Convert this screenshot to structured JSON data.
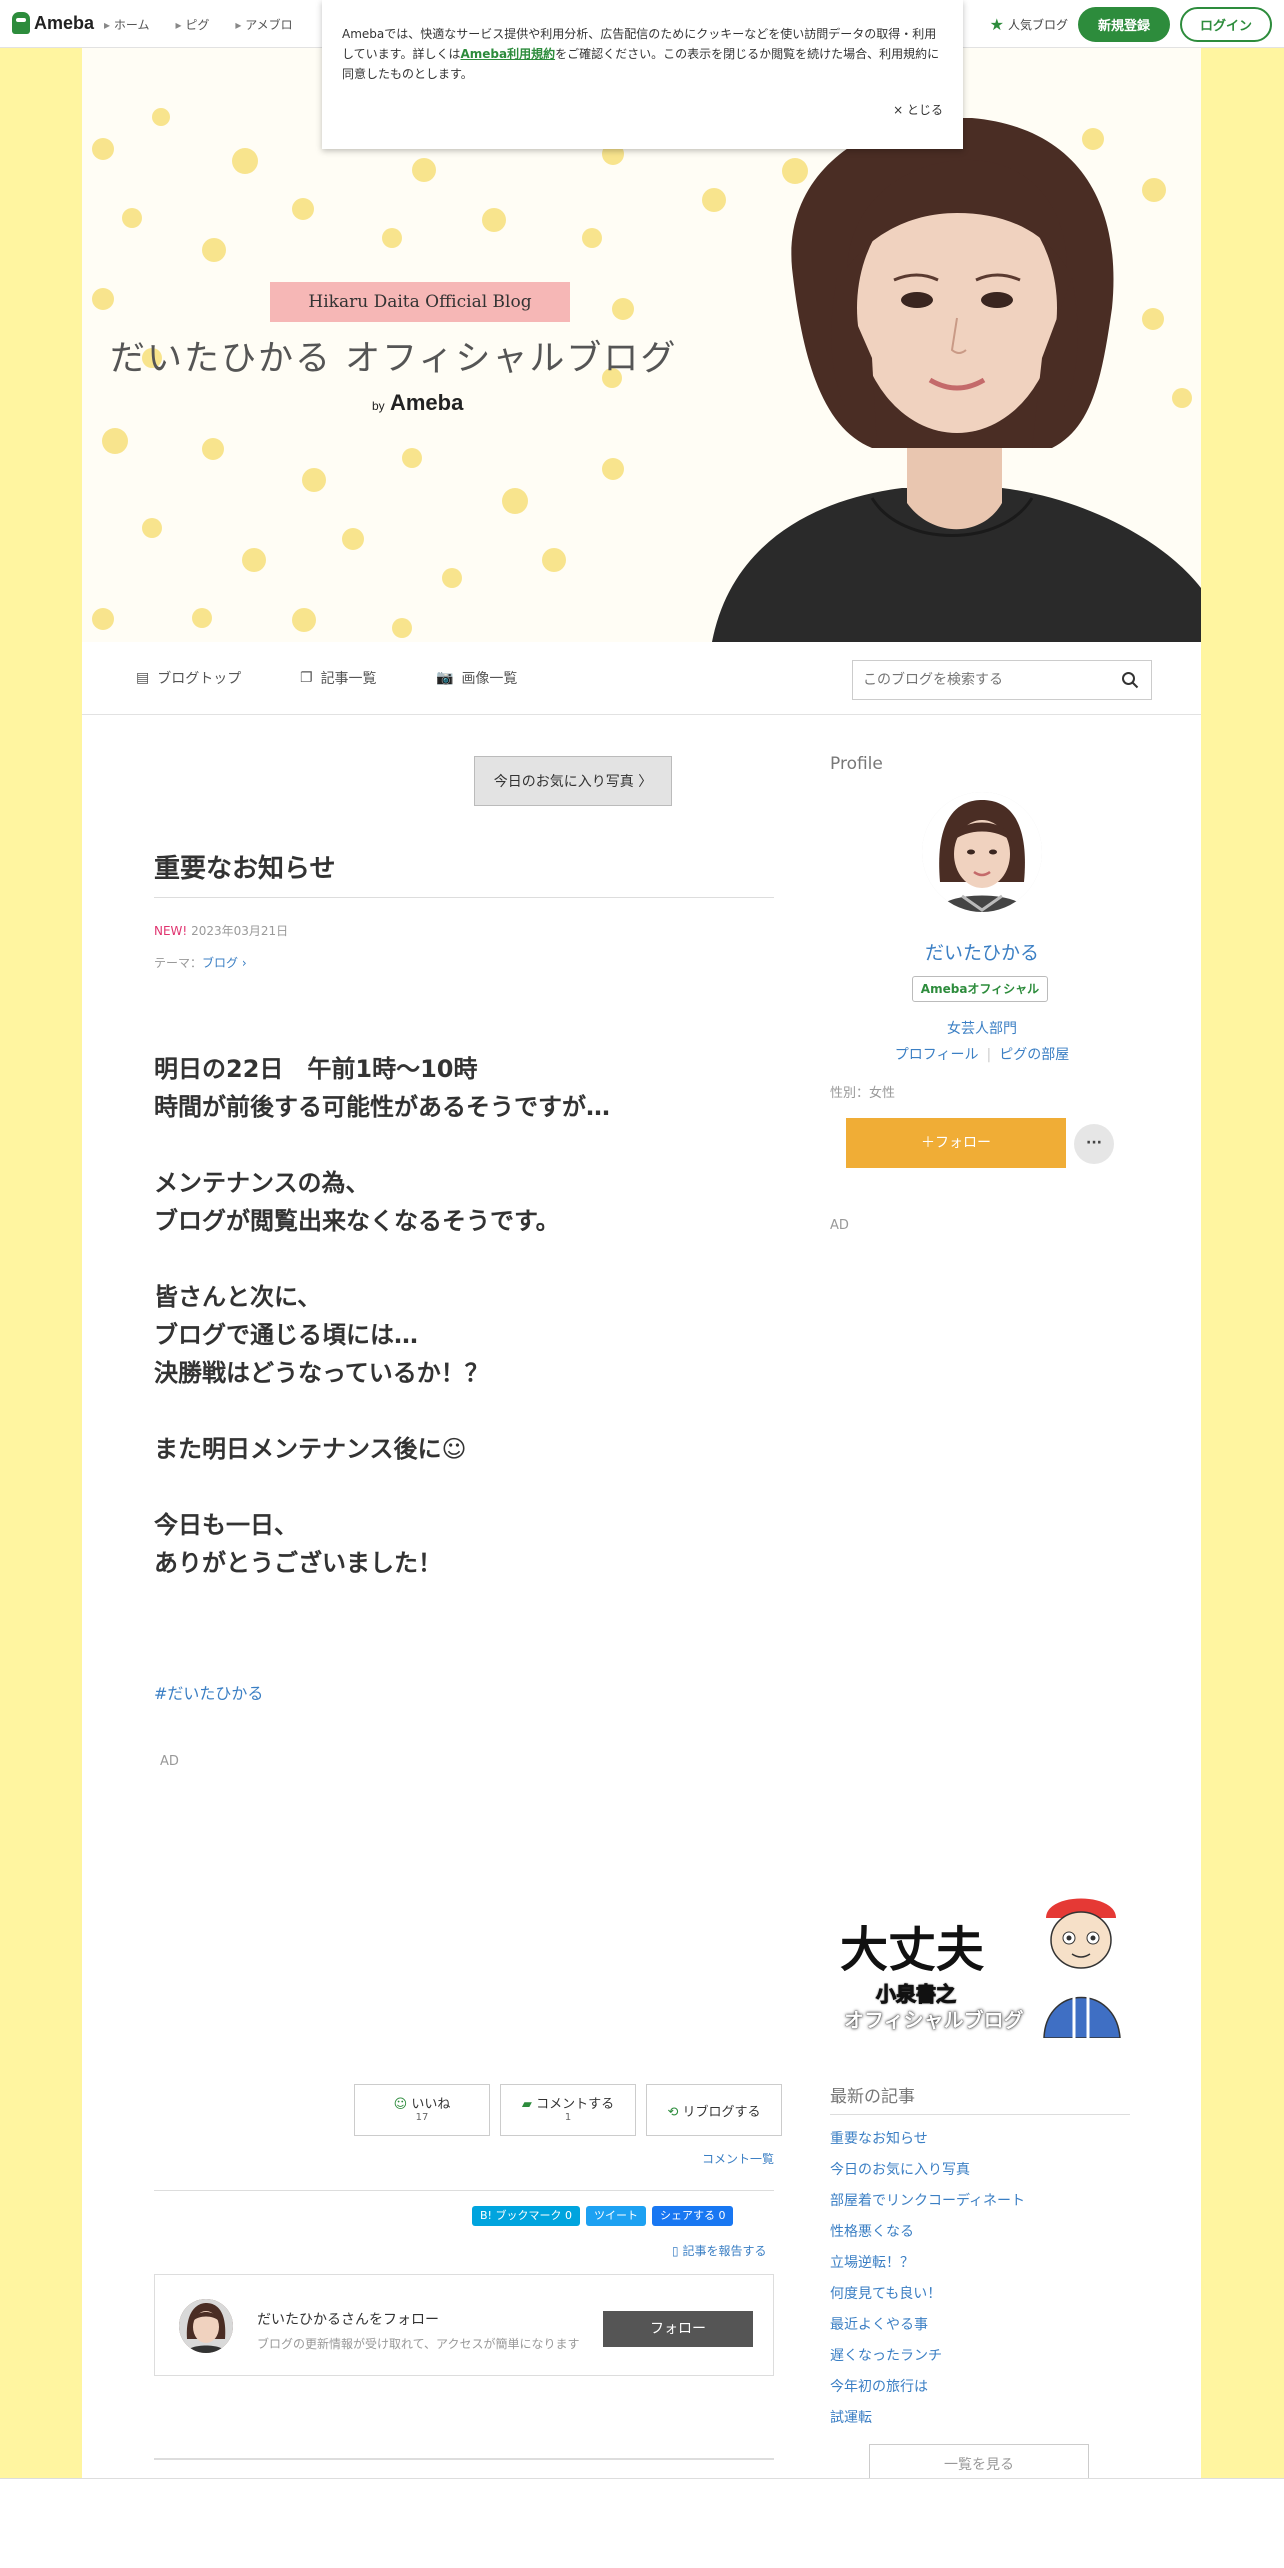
{
  "header": {
    "logo": "Ameba",
    "nav": [
      "ホーム",
      "ピグ",
      "アメブロ"
    ],
    "popular": "人気ブログ",
    "register": "新規登録",
    "login": "ログイン"
  },
  "cookie": {
    "text_before": "Amebaでは、快適なサービス提供や利用分析、広告配信のためにクッキーなどを使い訪問データの取得・利用しています。詳しくは",
    "link": "Ameba利用規約",
    "text_after": "をご確認ください。この表示を閉じるか閲覧を続けた場合、利用規約に同意したものとします。",
    "close": "× とじる"
  },
  "hero": {
    "ribbon": "Hikaru Daita Official Blog",
    "title": "だいたひかる オフィシャルブログ",
    "by": "by",
    "ameba": "Ameba"
  },
  "subnav": {
    "top": "ブログトップ",
    "list": "記事一覧",
    "images": "画像一覧",
    "search_placeholder": "このブログを検索する"
  },
  "article": {
    "prev_link": "今日のお気に入り写真",
    "title": "重要なお知らせ",
    "new_badge": "NEW!",
    "date": "2023年03月21日",
    "theme_label": "テーマ：",
    "theme": "ブログ",
    "body": [
      "明日の22日　午前1時〜10時",
      "時間が前後する可能性があるそうですが…",
      "",
      "メンテナンスの為、",
      "ブログが閲覧出来なくなるそうです。",
      "",
      "皆さんと次に、",
      "ブログで通じる頃には…",
      "決勝戦はどうなっているか！？",
      "",
      "また明日メンテナンス後に☺",
      "",
      "今日も一日、",
      "ありがとうございました！"
    ],
    "hashtag": "#だいたひかる",
    "ad": "AD",
    "like": "いいね",
    "like_count": "17",
    "comment": "コメントする",
    "comment_count": "1",
    "reblog": "リブログする",
    "comment_list": "コメント一覧",
    "bookmark": "B! ブックマーク  0",
    "tweet": "ツイート",
    "share": "シェアする 0",
    "report": "記事を報告する",
    "follow_name": "だいたひかるさんをフォロー",
    "follow_desc": "ブログの更新情報が受け取れて、アクセスが簡単になります",
    "follow_btn": "フォロー"
  },
  "sidebar": {
    "profile_heading": "Profile",
    "name": "だいたひかる",
    "official": "Amebaオフィシャル",
    "dept": "女芸人部門",
    "profile_link": "プロフィール",
    "pig_link": "ピグの部屋",
    "gender": "性別：女性",
    "follow": "＋フォロー",
    "more": "···",
    "ad": "AD",
    "banner_big": "大丈夫",
    "banner_sub1": "小泉書之",
    "banner_sub2": "オフィシャルブログ",
    "recent_heading": "最新の記事",
    "recent": [
      "重要なお知らせ",
      "今日のお気に入り写真",
      "部屋着でリンクコーディネート",
      "性格悪くなる",
      "立場逆転！？",
      "何度見ても良い！",
      "最近よくやる事",
      "遅くなったランチ",
      "今年初の旅行は",
      "試運転"
    ],
    "see_all": "一覧を見る"
  },
  "colors": {
    "brand_green": "#2d8c3c",
    "page_bg": "#fff5a0",
    "follow_orange": "#f0ad36",
    "link_blue": "#3b7fc4",
    "new_pink": "#e0336f"
  }
}
